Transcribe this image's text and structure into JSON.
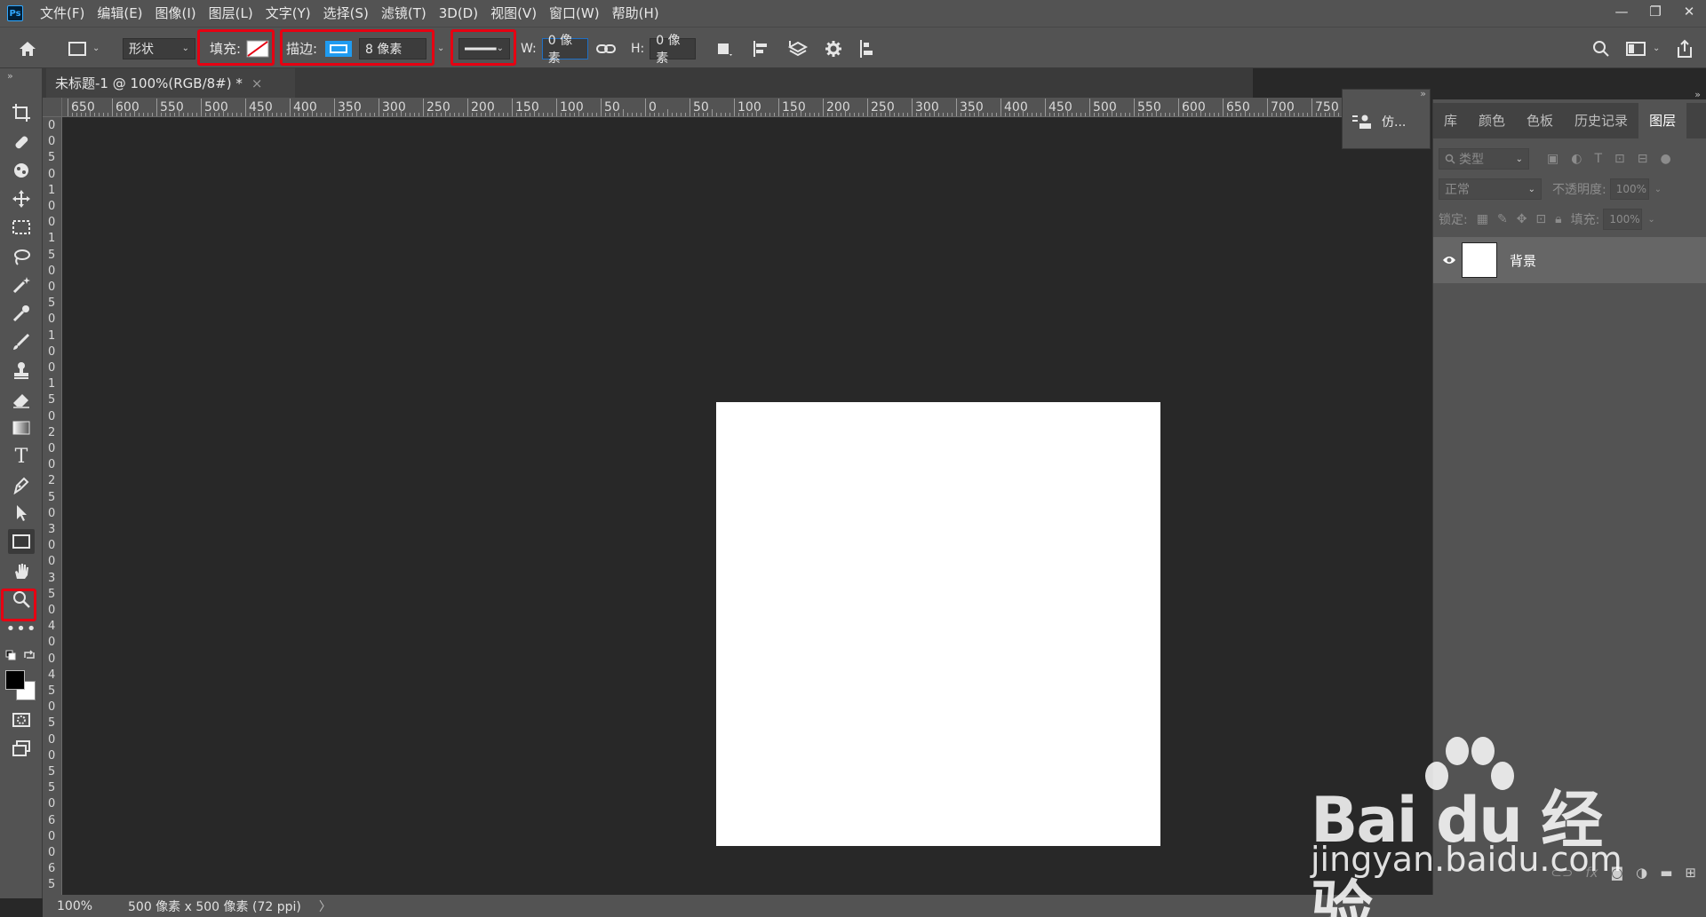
{
  "app": {
    "logo": "Ps"
  },
  "menu": [
    "文件(F)",
    "编辑(E)",
    "图像(I)",
    "图层(L)",
    "文字(Y)",
    "选择(S)",
    "滤镜(T)",
    "3D(D)",
    "视图(V)",
    "窗口(W)",
    "帮助(H)"
  ],
  "window_controls": {
    "minimize": "—",
    "restore": "❐",
    "close": "✕"
  },
  "options": {
    "mode": "形状",
    "fill_label": "填充:",
    "stroke_label": "描边:",
    "stroke_width": "8 像素",
    "w_label": "W:",
    "w_value": "0 像素",
    "h_label": "H:",
    "h_value": "0 像素",
    "highlight_color": "#e60012"
  },
  "document": {
    "tab_title": "未标题-1 @ 100%(RGB/8#) *",
    "close": "×"
  },
  "ruler_top": [
    "650",
    "600",
    "550",
    "500",
    "450",
    "400",
    "350",
    "300",
    "250",
    "200",
    "150",
    "100",
    "50",
    "0",
    "50",
    "100",
    "150",
    "200",
    "250",
    "300",
    "350",
    "400",
    "450",
    "500",
    "550",
    "600",
    "650",
    "700",
    "750"
  ],
  "ruler_left": [
    "0",
    "0",
    "5",
    "0",
    "1",
    "0",
    "0",
    "1",
    "5",
    "0",
    "0",
    "5",
    "0",
    "1",
    "0",
    "0",
    "1",
    "5",
    "0",
    "2",
    "0",
    "0",
    "2",
    "5",
    "0",
    "3",
    "0",
    "0",
    "3",
    "5",
    "0",
    "4",
    "0",
    "0",
    "4",
    "5",
    "0",
    "5",
    "0",
    "0",
    "5",
    "5",
    "0",
    "6",
    "0",
    "0",
    "6",
    "5"
  ],
  "mini_panel": {
    "label": "仿..."
  },
  "panels": {
    "tabs": [
      "库",
      "颜色",
      "色板",
      "历史记录",
      "图层"
    ],
    "active_tab": "图层",
    "filter_placeholder": "类型",
    "blend_mode": "正常",
    "opacity_label": "不透明度:",
    "opacity_value": "100%",
    "lock_label": "锁定:",
    "fill_label": "填充:",
    "fill_value": "100%",
    "layers": [
      {
        "name": "背景",
        "visible": true
      }
    ]
  },
  "status": {
    "zoom": "100%",
    "info": "500 像素 x 500 像素 (72 ppi)",
    "arrow": "〉"
  },
  "watermark": {
    "brand": "Bai du 经验",
    "url": "jingyan.baidu.com"
  }
}
